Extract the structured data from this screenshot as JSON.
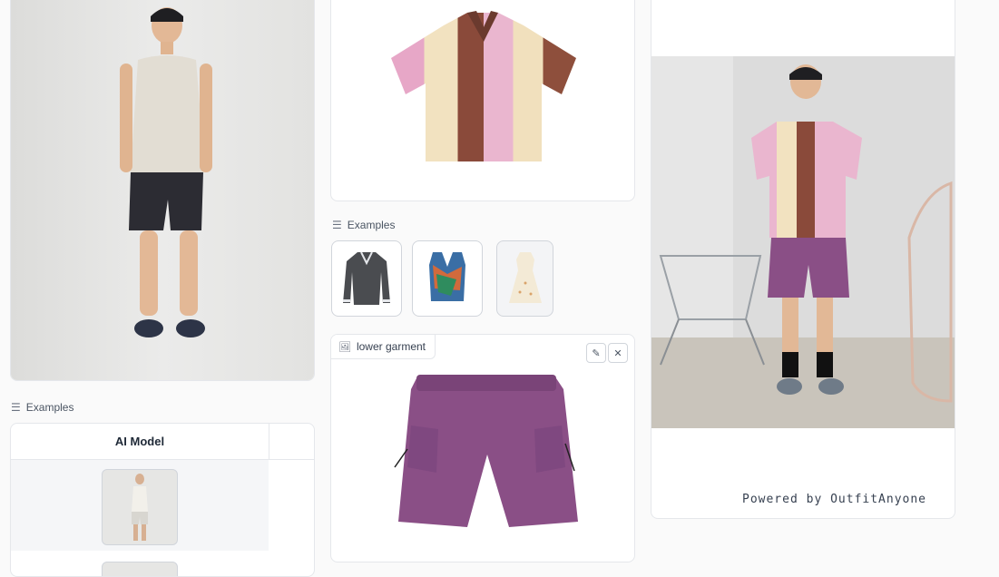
{
  "left_panel": {
    "examples_label": "Examples",
    "table": {
      "header": "AI Model"
    }
  },
  "middle_panel": {
    "examples_label": "Examples",
    "lower_garment_tag": "lower garment"
  },
  "right_panel": {
    "powered_by": "Powered by OutfitAnyone"
  },
  "icons": {
    "examples": "list-icon",
    "image": "image-icon",
    "edit": "pencil-icon",
    "close": "close-icon"
  }
}
